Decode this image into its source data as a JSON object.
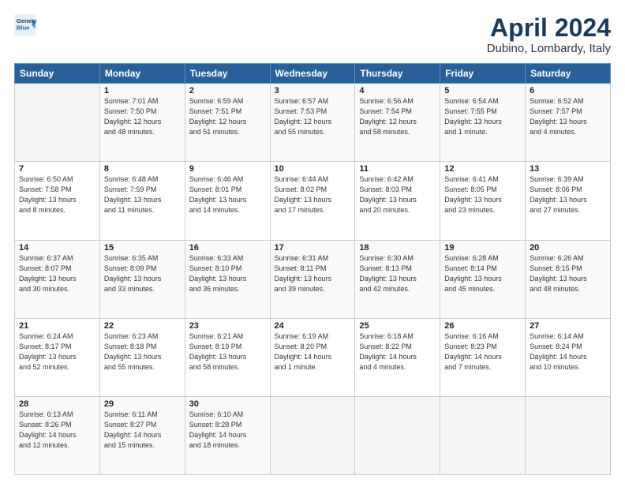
{
  "header": {
    "logo_line1": "General",
    "logo_line2": "Blue",
    "title": "April 2024",
    "subtitle": "Dubino, Lombardy, Italy"
  },
  "columns": [
    "Sunday",
    "Monday",
    "Tuesday",
    "Wednesday",
    "Thursday",
    "Friday",
    "Saturday"
  ],
  "weeks": [
    [
      {
        "day": "",
        "info": ""
      },
      {
        "day": "1",
        "info": "Sunrise: 7:01 AM\nSunset: 7:50 PM\nDaylight: 12 hours\nand 48 minutes."
      },
      {
        "day": "2",
        "info": "Sunrise: 6:59 AM\nSunset: 7:51 PM\nDaylight: 12 hours\nand 51 minutes."
      },
      {
        "day": "3",
        "info": "Sunrise: 6:57 AM\nSunset: 7:53 PM\nDaylight: 12 hours\nand 55 minutes."
      },
      {
        "day": "4",
        "info": "Sunrise: 6:56 AM\nSunset: 7:54 PM\nDaylight: 12 hours\nand 58 minutes."
      },
      {
        "day": "5",
        "info": "Sunrise: 6:54 AM\nSunset: 7:55 PM\nDaylight: 13 hours\nand 1 minute."
      },
      {
        "day": "6",
        "info": "Sunrise: 6:52 AM\nSunset: 7:57 PM\nDaylight: 13 hours\nand 4 minutes."
      }
    ],
    [
      {
        "day": "7",
        "info": "Sunrise: 6:50 AM\nSunset: 7:58 PM\nDaylight: 13 hours\nand 8 minutes."
      },
      {
        "day": "8",
        "info": "Sunrise: 6:48 AM\nSunset: 7:59 PM\nDaylight: 13 hours\nand 11 minutes."
      },
      {
        "day": "9",
        "info": "Sunrise: 6:46 AM\nSunset: 8:01 PM\nDaylight: 13 hours\nand 14 minutes."
      },
      {
        "day": "10",
        "info": "Sunrise: 6:44 AM\nSunset: 8:02 PM\nDaylight: 13 hours\nand 17 minutes."
      },
      {
        "day": "11",
        "info": "Sunrise: 6:42 AM\nSunset: 8:03 PM\nDaylight: 13 hours\nand 20 minutes."
      },
      {
        "day": "12",
        "info": "Sunrise: 6:41 AM\nSunset: 8:05 PM\nDaylight: 13 hours\nand 23 minutes."
      },
      {
        "day": "13",
        "info": "Sunrise: 6:39 AM\nSunset: 8:06 PM\nDaylight: 13 hours\nand 27 minutes."
      }
    ],
    [
      {
        "day": "14",
        "info": "Sunrise: 6:37 AM\nSunset: 8:07 PM\nDaylight: 13 hours\nand 30 minutes."
      },
      {
        "day": "15",
        "info": "Sunrise: 6:35 AM\nSunset: 8:09 PM\nDaylight: 13 hours\nand 33 minutes."
      },
      {
        "day": "16",
        "info": "Sunrise: 6:33 AM\nSunset: 8:10 PM\nDaylight: 13 hours\nand 36 minutes."
      },
      {
        "day": "17",
        "info": "Sunrise: 6:31 AM\nSunset: 8:11 PM\nDaylight: 13 hours\nand 39 minutes."
      },
      {
        "day": "18",
        "info": "Sunrise: 6:30 AM\nSunset: 8:13 PM\nDaylight: 13 hours\nand 42 minutes."
      },
      {
        "day": "19",
        "info": "Sunrise: 6:28 AM\nSunset: 8:14 PM\nDaylight: 13 hours\nand 45 minutes."
      },
      {
        "day": "20",
        "info": "Sunrise: 6:26 AM\nSunset: 8:15 PM\nDaylight: 13 hours\nand 48 minutes."
      }
    ],
    [
      {
        "day": "21",
        "info": "Sunrise: 6:24 AM\nSunset: 8:17 PM\nDaylight: 13 hours\nand 52 minutes."
      },
      {
        "day": "22",
        "info": "Sunrise: 6:23 AM\nSunset: 8:18 PM\nDaylight: 13 hours\nand 55 minutes."
      },
      {
        "day": "23",
        "info": "Sunrise: 6:21 AM\nSunset: 8:19 PM\nDaylight: 13 hours\nand 58 minutes."
      },
      {
        "day": "24",
        "info": "Sunrise: 6:19 AM\nSunset: 8:20 PM\nDaylight: 14 hours\nand 1 minute."
      },
      {
        "day": "25",
        "info": "Sunrise: 6:18 AM\nSunset: 8:22 PM\nDaylight: 14 hours\nand 4 minutes."
      },
      {
        "day": "26",
        "info": "Sunrise: 6:16 AM\nSunset: 8:23 PM\nDaylight: 14 hours\nand 7 minutes."
      },
      {
        "day": "27",
        "info": "Sunrise: 6:14 AM\nSunset: 8:24 PM\nDaylight: 14 hours\nand 10 minutes."
      }
    ],
    [
      {
        "day": "28",
        "info": "Sunrise: 6:13 AM\nSunset: 8:26 PM\nDaylight: 14 hours\nand 12 minutes."
      },
      {
        "day": "29",
        "info": "Sunrise: 6:11 AM\nSunset: 8:27 PM\nDaylight: 14 hours\nand 15 minutes."
      },
      {
        "day": "30",
        "info": "Sunrise: 6:10 AM\nSunset: 8:28 PM\nDaylight: 14 hours\nand 18 minutes."
      },
      {
        "day": "",
        "info": ""
      },
      {
        "day": "",
        "info": ""
      },
      {
        "day": "",
        "info": ""
      },
      {
        "day": "",
        "info": ""
      }
    ]
  ]
}
